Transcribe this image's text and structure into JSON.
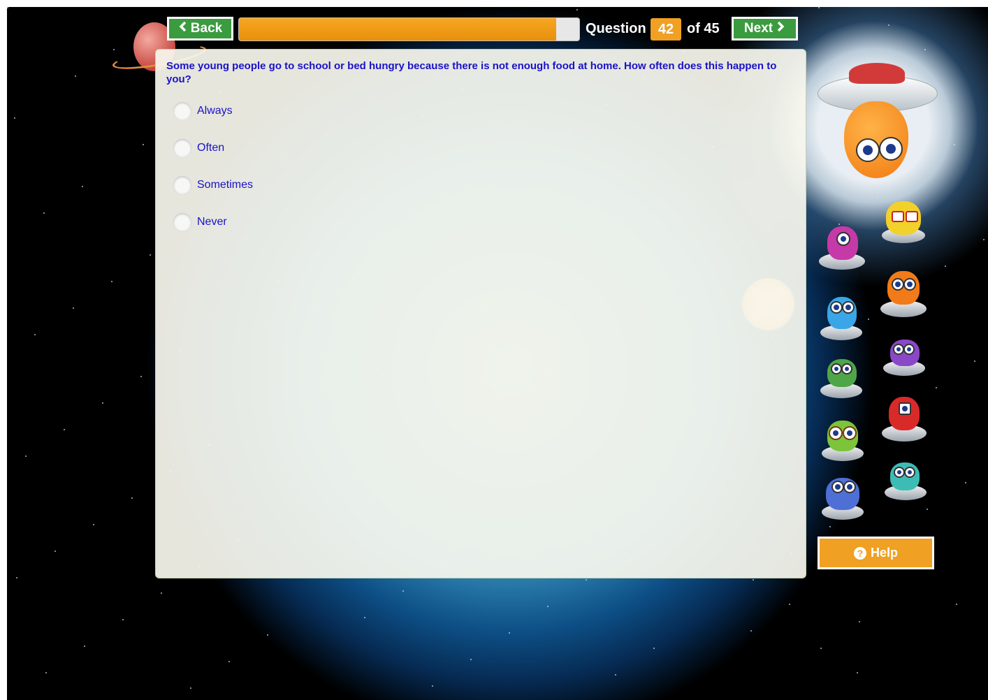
{
  "nav": {
    "back_label": "Back",
    "back_icon": "chevron-left-icon",
    "next_label": "Next",
    "next_icon": "chevron-right-icon"
  },
  "progress": {
    "fraction": 0.933,
    "question_word": "Question",
    "current": "42",
    "total_text": "of 45"
  },
  "question": {
    "text": "Some young people go to school or bed hungry because there is not enough food at home. How often does this happen to you?",
    "options": [
      {
        "label": "Always"
      },
      {
        "label": "Often"
      },
      {
        "label": "Sometimes"
      },
      {
        "label": "Never"
      }
    ]
  },
  "help": {
    "label": "Help",
    "icon": "question-circle-icon"
  },
  "colors": {
    "nav_green": "#3a9b3f",
    "accent_orange": "#f0a022",
    "question_text": "#1a12c8"
  }
}
